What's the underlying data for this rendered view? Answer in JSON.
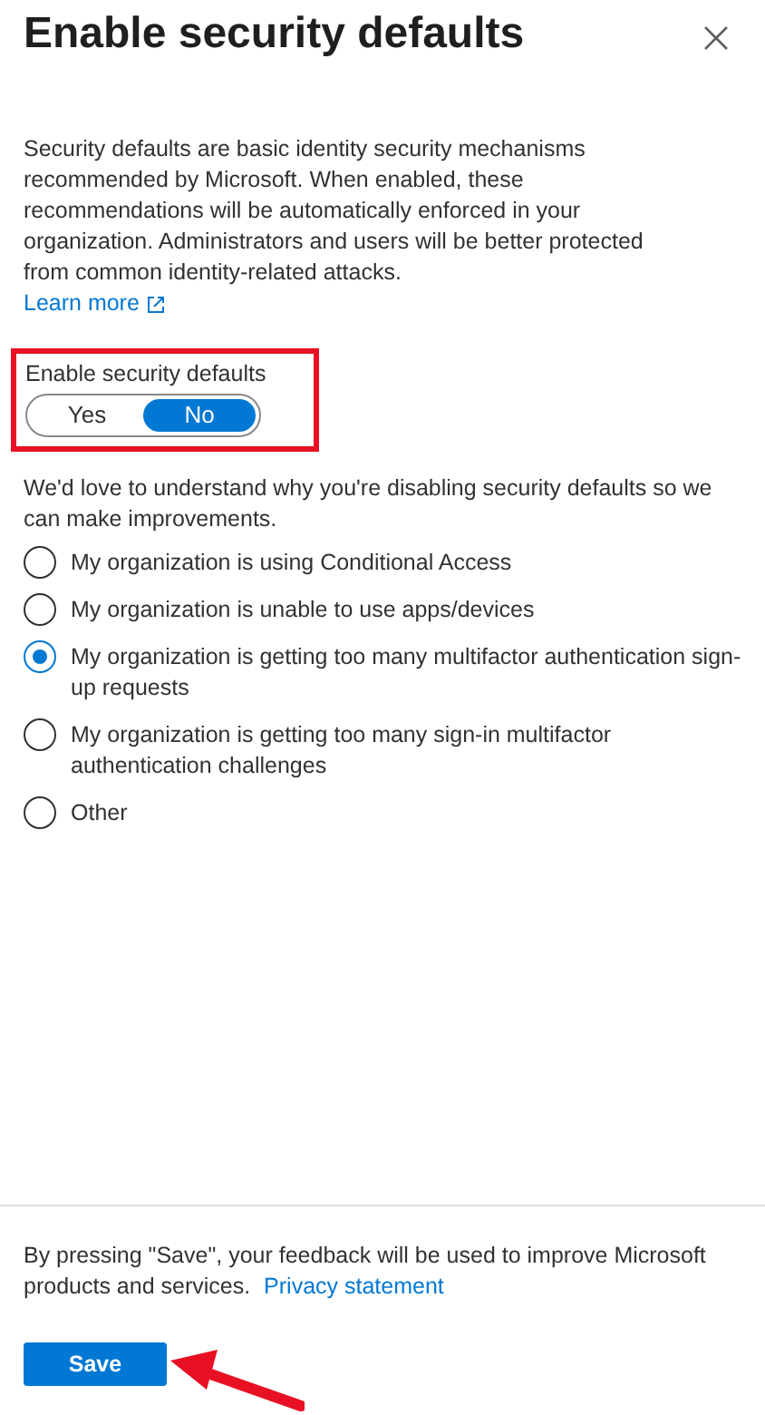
{
  "title": "Enable security defaults",
  "description": "Security defaults are basic identity security mechanisms recommended by Microsoft. When enabled, these recommendations will be automatically enforced in your organization. Administrators and users will be better protected from common identity-related attacks.",
  "learn_more": "Learn more",
  "toggle": {
    "label": "Enable security defaults",
    "options": [
      {
        "label": "Yes",
        "selected": false
      },
      {
        "label": "No",
        "selected": true
      }
    ]
  },
  "survey": {
    "prompt": "We'd love to understand why you're disabling security defaults so we can make improvements.",
    "options": [
      {
        "label": "My organization is using Conditional Access",
        "selected": false
      },
      {
        "label": "My organization is unable to use apps/devices",
        "selected": false
      },
      {
        "label": "My organization is getting too many multifactor authentication sign-up requests",
        "selected": true
      },
      {
        "label": "My organization is getting too many sign-in multifactor authentication challenges",
        "selected": false
      },
      {
        "label": "Other",
        "selected": false
      }
    ]
  },
  "footer": {
    "notice": "By pressing \"Save\", your feedback will be used to improve Microsoft products and services.",
    "privacy_link": "Privacy statement",
    "save_button": "Save"
  }
}
